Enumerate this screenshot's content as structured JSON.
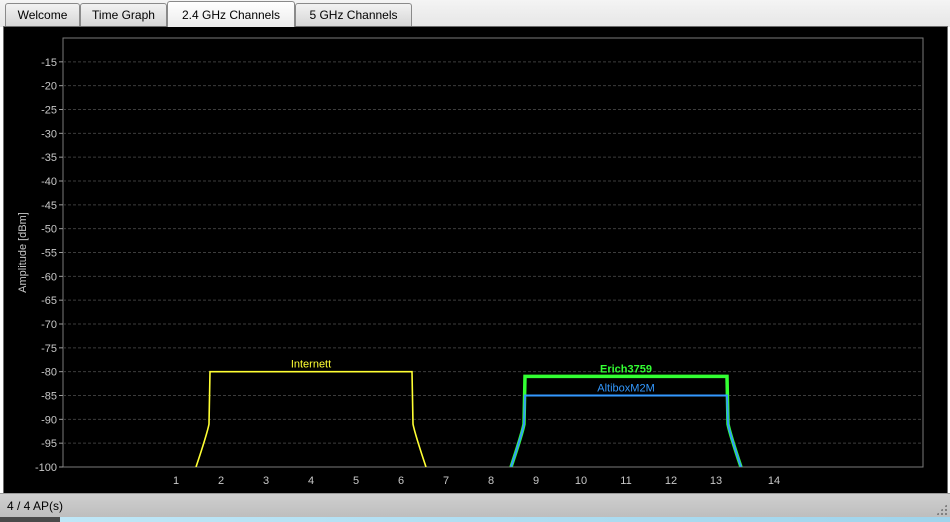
{
  "tabs": [
    {
      "label": "Welcome",
      "active": false
    },
    {
      "label": "Time Graph",
      "active": false
    },
    {
      "label": "2.4 GHz Channels",
      "active": true
    },
    {
      "label": "5 GHz Channels",
      "active": false
    }
  ],
  "status": {
    "ap_count": "4 / 4 AP(s)"
  },
  "chart_data": {
    "type": "line",
    "title": "",
    "xlabel": "",
    "ylabel": "Amplitude [dBm]",
    "ylim": [
      -100,
      -10
    ],
    "y_ticks": [
      "-15",
      "-20",
      "-25",
      "-30",
      "-35",
      "-40",
      "-45",
      "-50",
      "-55",
      "-60",
      "-65",
      "-70",
      "-75",
      "-80",
      "-85",
      "-90",
      "-95",
      "-100"
    ],
    "x_ticks": [
      "1",
      "2",
      "3",
      "4",
      "5",
      "6",
      "7",
      "8",
      "9",
      "10",
      "11",
      "12",
      "13",
      "14"
    ],
    "grid": true,
    "series": [
      {
        "name": "Internett",
        "channel": 4,
        "amplitude": -80,
        "color": "#ffff33"
      },
      {
        "name": "Erich3759",
        "channel": 11,
        "amplitude": -81,
        "color": "#33ff33"
      },
      {
        "name": "AltiboxM2M",
        "channel": 11,
        "amplitude": -85,
        "color": "#3399ff"
      }
    ]
  },
  "colors": {
    "plot_background": "#000000",
    "grid": "#3c3c3c",
    "axis_text": "#c8c8c8"
  }
}
